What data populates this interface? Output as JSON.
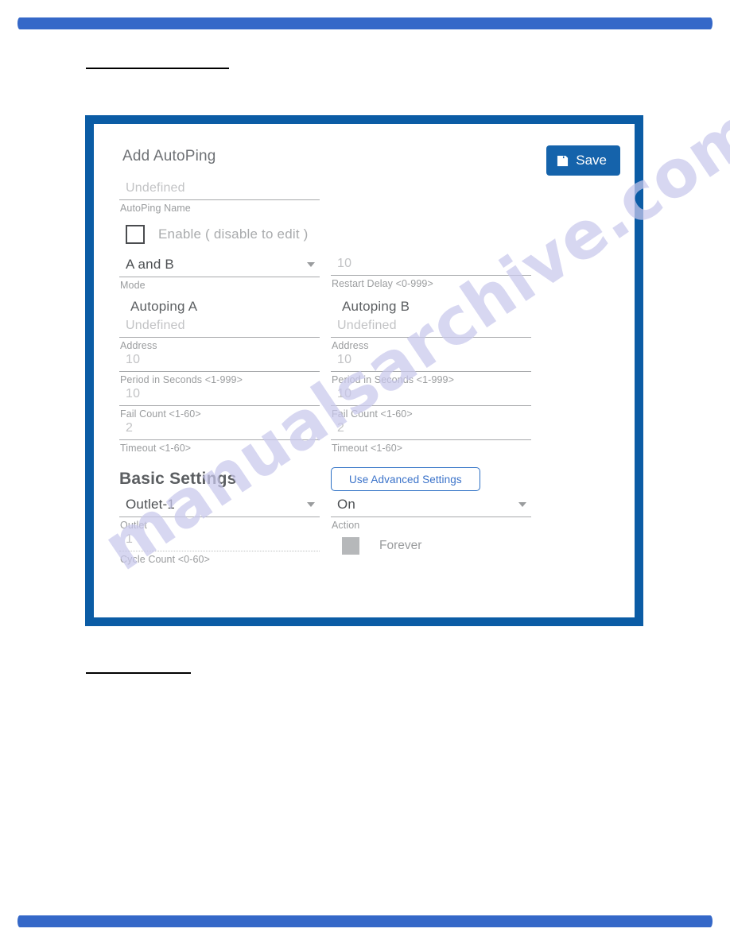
{
  "colors": {
    "page_bar": "#3568c8",
    "card_border": "#0b5ca5",
    "save_bg": "#1563ab",
    "advanced_accent": "#3a72c9",
    "watermark": "#c9c8ec"
  },
  "watermark": {
    "text": "manualsarchive.com"
  },
  "card": {
    "title": "Add AutoPing",
    "save_label": "Save",
    "name_field": {
      "value": "Undefined",
      "label": "AutoPing Name"
    },
    "enable": {
      "label": "Enable ( disable to edit )",
      "checked": false
    },
    "mode": {
      "value": "A and B",
      "label": "Mode"
    },
    "restart_delay": {
      "value": "10",
      "label": "Restart Delay <0-999>"
    },
    "autoping_a": {
      "heading": "Autoping A",
      "fields": [
        {
          "value": "Undefined",
          "label": "Address"
        },
        {
          "value": "10",
          "label": "Period in Seconds <1-999>"
        },
        {
          "value": "10",
          "label": "Fail Count <1-60>"
        },
        {
          "value": "2",
          "label": "Timeout <1-60>"
        }
      ]
    },
    "autoping_b": {
      "heading": "Autoping B",
      "fields": [
        {
          "value": "Undefined",
          "label": "Address"
        },
        {
          "value": "10",
          "label": "Period in Seconds <1-999>"
        },
        {
          "value": "10",
          "label": "Fail Count <1-60>"
        },
        {
          "value": "2",
          "label": "Timeout <1-60>"
        }
      ]
    },
    "basic_settings": {
      "title": "Basic Settings",
      "advanced_button": "Use Advanced Settings",
      "outlet": {
        "value": "Outlet-1",
        "label": "Outlet"
      },
      "action": {
        "value": "On",
        "label": "Action"
      },
      "cycle_count": {
        "value": "1",
        "label": "Cycle Count <0-60>"
      },
      "forever": {
        "label": "Forever",
        "checked": false
      }
    }
  }
}
